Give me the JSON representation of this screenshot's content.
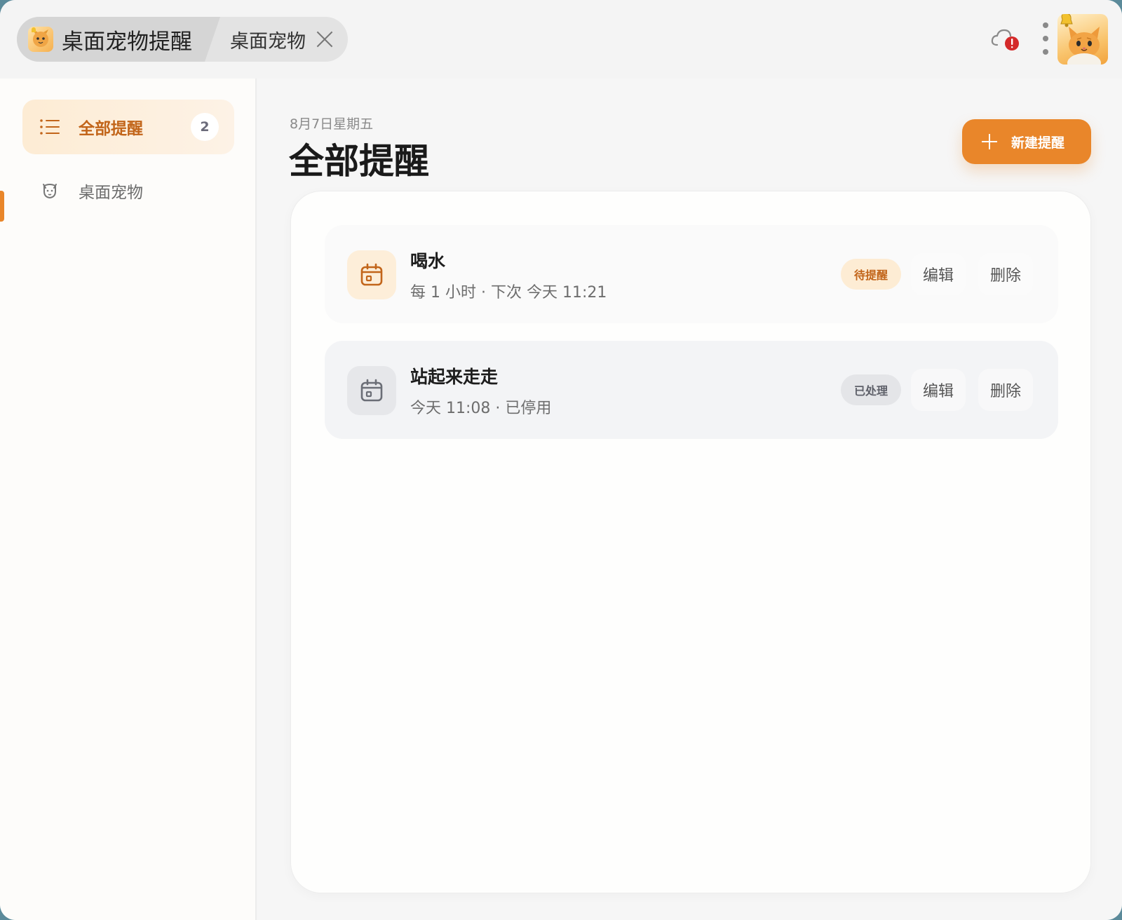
{
  "titlebar": {
    "tabs": [
      {
        "label": "桌面宠物提醒",
        "active": true
      },
      {
        "label": "桌面宠物",
        "active": false
      }
    ]
  },
  "sidebar": {
    "items": [
      {
        "label": "全部提醒",
        "count": "2",
        "icon": "list-icon",
        "active": true
      },
      {
        "label": "桌面宠物",
        "icon": "pet-icon",
        "active": false
      }
    ]
  },
  "main": {
    "date": "8月7日星期五",
    "title": "全部提醒",
    "new_button": "新建提醒",
    "reminders": [
      {
        "title": "喝水",
        "subtitle": "每 1 小时 · 下次 今天 11:21",
        "status": "待提醒",
        "edit": "编辑",
        "delete": "删除"
      },
      {
        "title": "站起来走走",
        "subtitle": "今天 11:08 · 已停用",
        "status": "已处理",
        "edit": "编辑",
        "delete": "删除"
      }
    ]
  },
  "colors": {
    "accent": "#e9862a",
    "accent_text": "#c2651a",
    "alert": "#d42a2a"
  }
}
